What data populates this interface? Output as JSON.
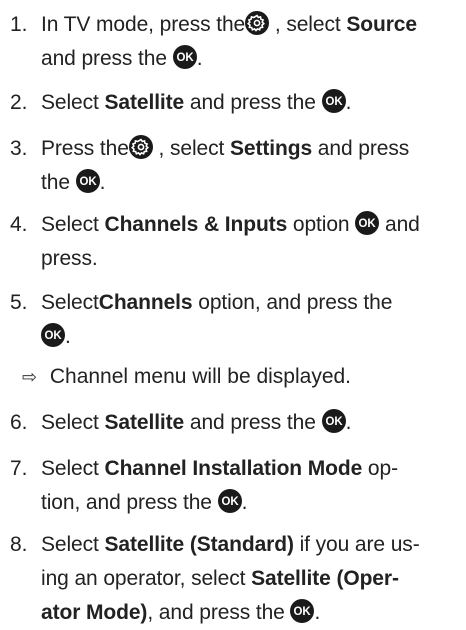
{
  "steps": [
    {
      "num": "1.",
      "t1": "In TV mode, press the",
      "t2": " , select ",
      "b1": "Source",
      "t3": "and press the ",
      "t4": "."
    },
    {
      "num": "2.",
      "t1": "Select ",
      "b1": "Satellite",
      "t2": "  and press the ",
      "t3": "."
    },
    {
      "num": "3.",
      "t1": "Press the",
      "t2": " , select ",
      "b1": "Settings",
      "t3": " and press",
      "t4": "the ",
      "t5": "."
    },
    {
      "num": "4.",
      "t1": "Select ",
      "b1": "Channels & Inputs",
      "t2": " option ",
      "t3": " and",
      "t4": "press."
    },
    {
      "num": "5.",
      "t1": "Select",
      "b1": "Channels",
      "t2": " option, and press the",
      "t3": "."
    },
    {
      "num": "6.",
      "t1": "Select ",
      "b1": "Satellite",
      "t2": "  and press the ",
      "t3": "."
    },
    {
      "num": "7.",
      "t1": "Select ",
      "b1": "Channel Installation Mode",
      "t2": " op-",
      "t3": "tion, and press the ",
      "t4": "."
    },
    {
      "num": "8.",
      "t1": "Select ",
      "b1": "Satellite (Standard)",
      "t2": " if you are us-",
      "t3": "ing an operator, select ",
      "b2": "Satellite (Oper-",
      "b3": "ator Mode)",
      "t4": ", and press the ",
      "t5": "."
    }
  ],
  "result": {
    "arrow": "⇨",
    "text": "Channel menu will be displayed."
  },
  "icons": {
    "settings": "settings-icon",
    "ok": "ok-button-icon"
  },
  "colors": {
    "text": "#222222",
    "icon": "#1a1a1a"
  }
}
